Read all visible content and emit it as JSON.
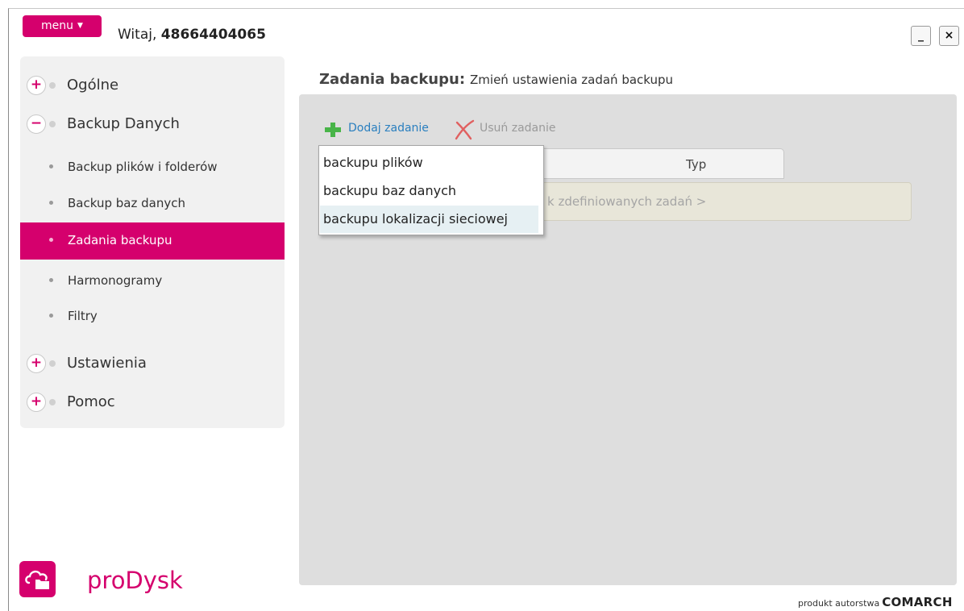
{
  "header": {
    "menu_label": "menu",
    "greeting_prefix": "Witaj, ",
    "username": "48664404065",
    "minimize_label": "_",
    "close_label": "×"
  },
  "sidebar": {
    "items": [
      {
        "label": "Ogólne",
        "state": "+"
      },
      {
        "label": "Backup Danych",
        "state": "−"
      },
      {
        "label": "Backup plików i folderów"
      },
      {
        "label": "Backup baz danych"
      },
      {
        "label": "Zadania backupu",
        "active": true
      },
      {
        "label": "Harmonogramy"
      },
      {
        "label": "Filtry"
      },
      {
        "label": "Ustawienia",
        "state": "+"
      },
      {
        "label": "Pomoc",
        "state": "+"
      }
    ]
  },
  "content": {
    "title": "Zadania backupu:",
    "subtitle": "Zmień ustawienia zadań backupu"
  },
  "toolbar": {
    "add_label": "Dodaj zadanie",
    "delete_label": "Usuń zadanie"
  },
  "grid": {
    "columns": [
      "Typ"
    ],
    "empty_message": "k zdefiniowanych zadań >"
  },
  "dropdown": {
    "items": [
      "backupu plików",
      "backupu baz danych",
      "backupu lokalizacji sieciowej"
    ],
    "highlighted_index": 2
  },
  "brand": {
    "product_name": "proDysk",
    "footer_prefix": "produkt autorstwa",
    "footer_brand": "COMARCH",
    "accent_color": "#d5006d"
  }
}
